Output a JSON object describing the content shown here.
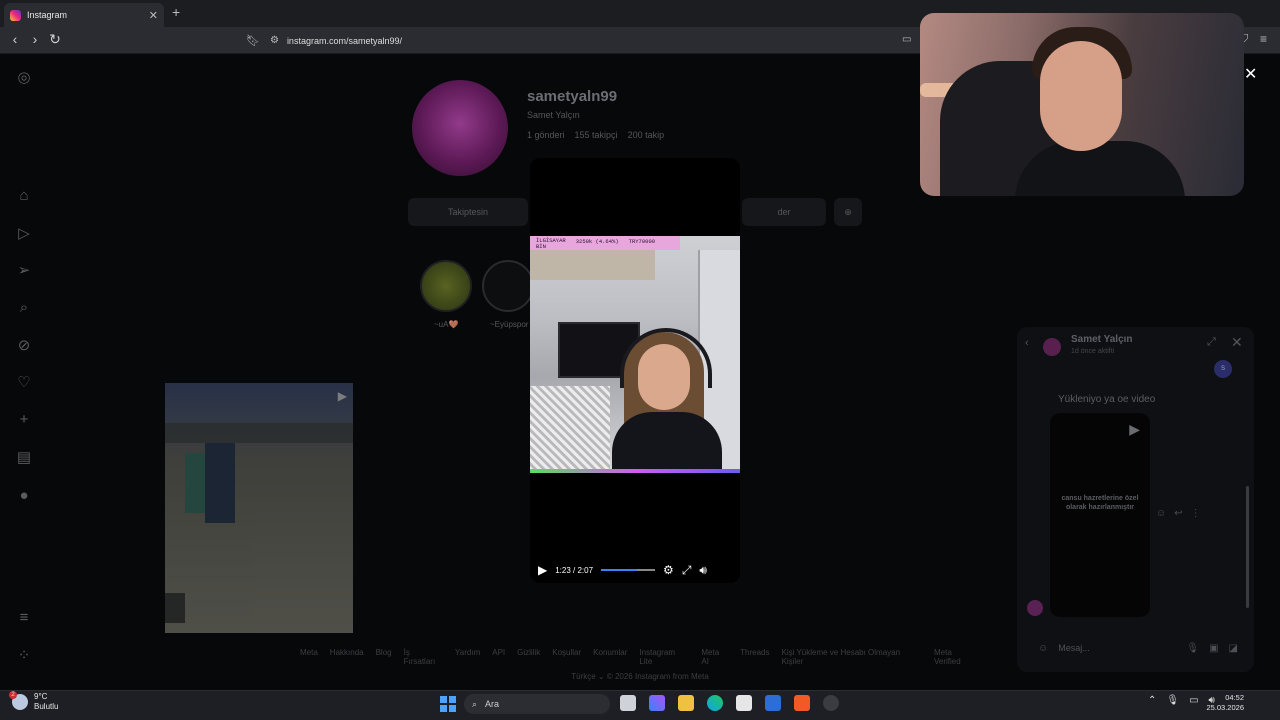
{
  "browser": {
    "tab_title": "Instagram",
    "url": "instagram.com/sametyaln99/"
  },
  "profile": {
    "username": "sametyaln99",
    "display_name": "Samet Yalçın",
    "posts": "1 gönderi",
    "followers": "155 takipçi",
    "following": "200 takip",
    "follow_button": "Takiptesin",
    "message_button": "der",
    "highlights": [
      {
        "label": "~uA🤎"
      },
      {
        "label": "~Eyüpspor"
      }
    ]
  },
  "video": {
    "stream_overlay_left": "İLGİSAYAR\nBİN",
    "stream_overlay_mid": "3250k (4.64%)",
    "stream_overlay_right": "TRY70000",
    "time": "1:23 / 2:07",
    "progress": 0.66
  },
  "chat": {
    "contact_name": "Samet Yalçın",
    "contact_status": "1d önce aktifti",
    "my_initial": "S",
    "message": "Yükleniyo ya oe video",
    "video_caption": "cansu hazretlerine özel olarak hazırlanmıştır",
    "input_placeholder": "Mesaj..."
  },
  "footer": {
    "links": [
      "Meta",
      "Hakkında",
      "Blog",
      "İş Fırsatları",
      "Yardım",
      "API",
      "Gizlilik",
      "Koşullar",
      "Konumlar",
      "Instagram Lite",
      "Meta AI",
      "Threads",
      "Kişi Yükleme ve Hesabı Olmayan Kişiler",
      "Meta Verified"
    ],
    "language": "Türkçe",
    "copyright": "© 2026 Instagram from Meta"
  },
  "taskbar": {
    "weather_temp": "9°C",
    "weather_desc": "Bulutlu",
    "search_placeholder": "Ara",
    "time": "04:52",
    "date": "25.03.2026"
  },
  "colors": {
    "accent": "#3b82f6",
    "instagram_gradient": "#ee2a7b"
  }
}
